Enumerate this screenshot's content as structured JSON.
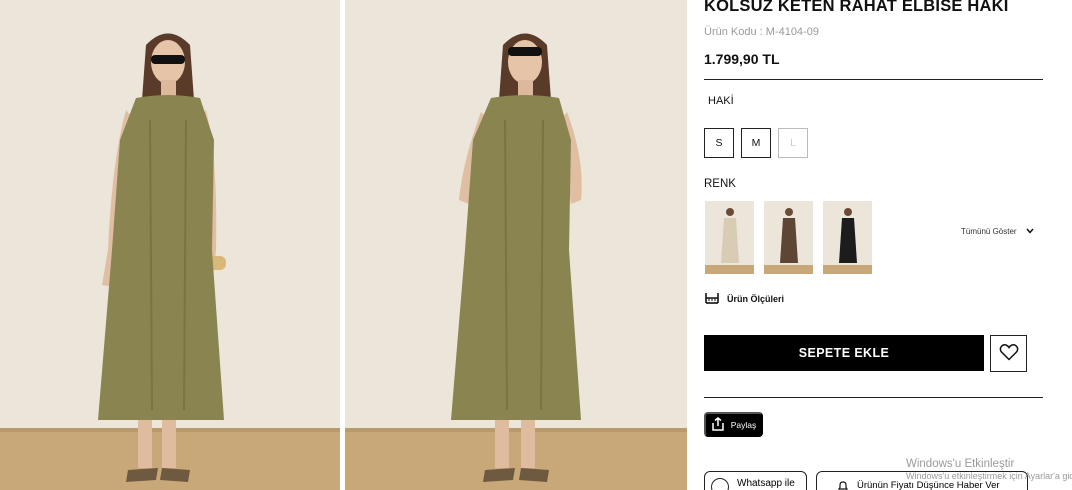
{
  "product": {
    "title": "KOLSUZ KETEN RAHAT ELBİSE HAKİ",
    "sku": "Ürün Kodu : M-4104-09",
    "price": "1.799,90 TL",
    "color_name": "HAKİ"
  },
  "sizes": [
    {
      "label": "S",
      "available": true
    },
    {
      "label": "M",
      "available": true
    },
    {
      "label": "L",
      "available": false
    }
  ],
  "color_section": {
    "label": "RENK",
    "show_all": "Tümünü Göster",
    "swatch_colors": [
      "#d9ccb4",
      "#5e4636",
      "#1c1c1c"
    ]
  },
  "measurements_link": "Ürün Ölçüleri",
  "buttons": {
    "add_to_cart": "SEPETE EKLE",
    "share": "Paylaş",
    "whatsapp": "Whatsapp ile",
    "price_alert": "Ürünün Fiyatı Düşünce Haber Ver"
  },
  "watermark": {
    "line1": "Windows'u Etkinleştir",
    "line2": "Windows'u etkinleştirmek için Ayarlar'a gidin."
  },
  "colors": {
    "dress_khaki": "#8a8450",
    "wall": "#ede6dc",
    "floor": "#c9a97a",
    "accent_black": "#000000"
  }
}
